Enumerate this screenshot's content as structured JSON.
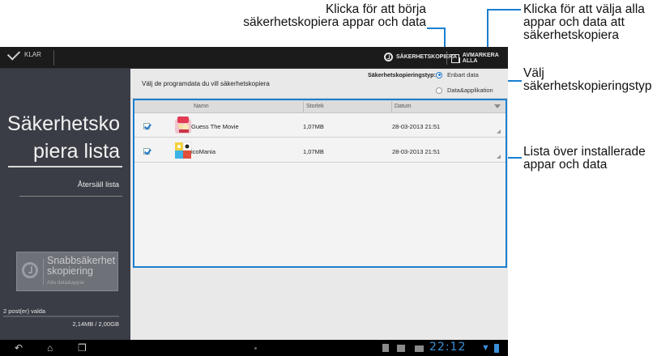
{
  "callouts": {
    "backup": {
      "line1": "Klicka för att börja",
      "line2": "säkerhetskopiera appar och data"
    },
    "deselect": {
      "line1": "Klicka för att välja alla",
      "line2": "appar och data att",
      "line3": "säkerhetskopiera"
    },
    "type": {
      "line1": "Välj",
      "line2": "säkerhetskopieringstyp"
    },
    "list": {
      "line1": "Lista över installerade",
      "line2": "appar och data"
    }
  },
  "actionbar": {
    "done_label": "KLAR",
    "backup_label": "SÄKERHETSKOPIERA",
    "deselect_label": "AVMARKERA ALLA"
  },
  "sidebar": {
    "title_line1": "Säkerhetsko",
    "title_line2": "piera lista",
    "restore_label": "Återsäll lista",
    "quick_backup": {
      "title": "Snabbsäkerhet skopiering",
      "subtitle": "Alla data&appar"
    },
    "selected_count": "2 post(er) valda",
    "size_summary": "2,14MB / 2,00GB"
  },
  "content": {
    "instruction": "Välj de programdata du vill säkerhetskopiera",
    "backup_type_label": "Säkerhetskopieringstyp:",
    "backup_type_options": [
      {
        "label": "Enbart data",
        "selected": true
      },
      {
        "label": "Data&applikation",
        "selected": false
      }
    ],
    "columns": {
      "name": "Namn",
      "size": "Storlek",
      "date": "Datum"
    },
    "rows": [
      {
        "name": "Guess The Movie",
        "size": "1,07MB",
        "date": "28-03-2013 21:51",
        "checked": true,
        "icon": "guess-the-movie-app-icon"
      },
      {
        "name": "icoMania",
        "size": "1,07MB",
        "date": "28-03-2013 21:51",
        "checked": true,
        "icon": "icomania-app-icon"
      }
    ]
  },
  "statusbar": {
    "time": "22:12"
  },
  "colors": {
    "accent": "#1a7fd0",
    "sidebar": "#3a3d45",
    "actionbar": "#1b1b1b"
  }
}
